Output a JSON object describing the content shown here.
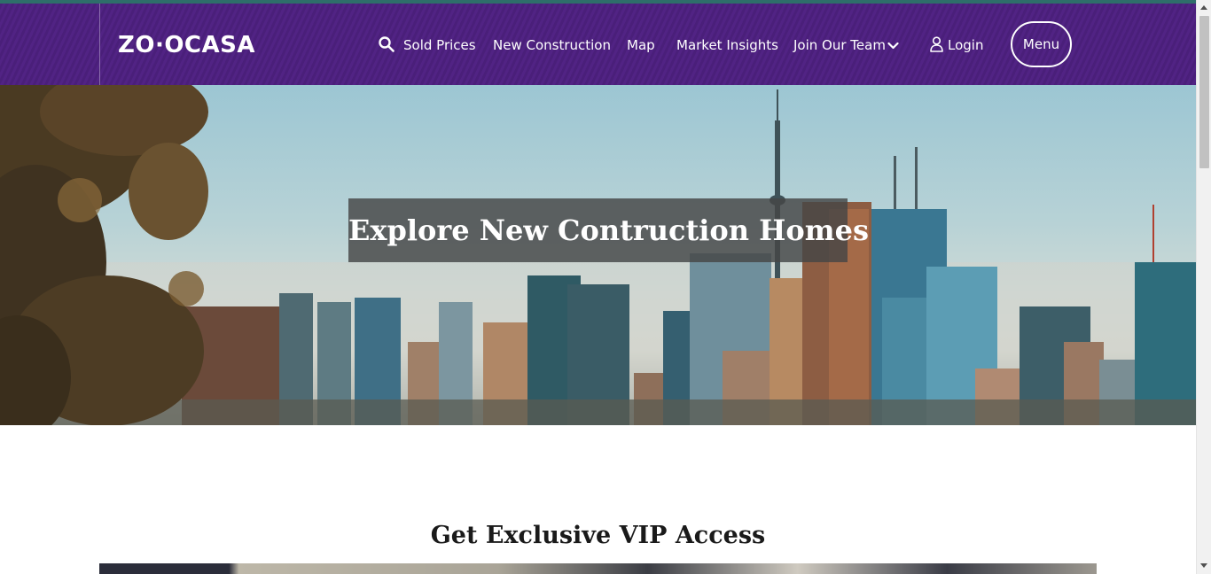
{
  "header": {
    "logo": "ZO·OCASA",
    "nav": {
      "search_icon": "search-icon",
      "sold_prices": "Sold Prices",
      "new_construction": "New Construction",
      "map": "Map",
      "market_insights": "Market Insights",
      "join_our_team": "Join Our Team",
      "login_icon": "user-icon",
      "login": "Login",
      "menu": "Menu"
    },
    "colors": {
      "nav_bg": "#4a1f7a",
      "text": "#ffffff"
    }
  },
  "hero": {
    "title": "Explore New Contruction Homes"
  },
  "vip": {
    "heading": "Get Exclusive VIP Access"
  }
}
